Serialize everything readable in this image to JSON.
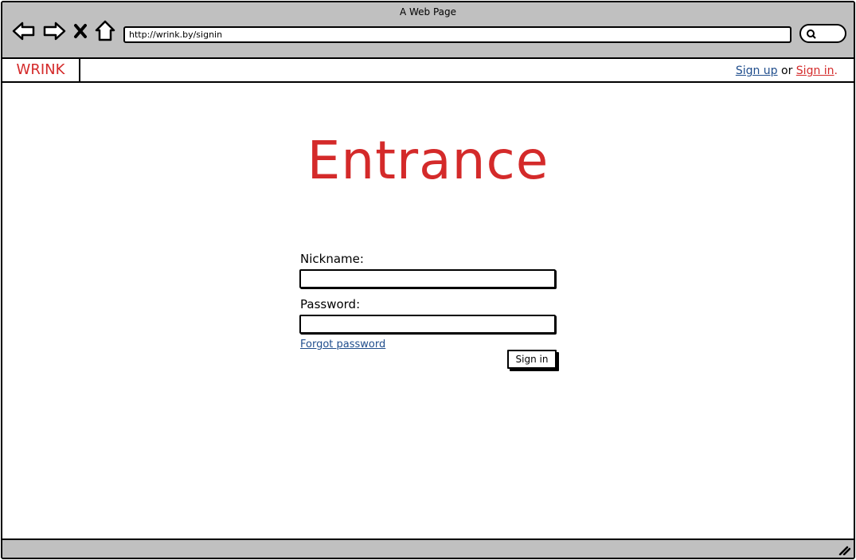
{
  "window": {
    "title": "A Web Page"
  },
  "browser": {
    "url": "http://wrink.by/signin",
    "icons": [
      "back-arrow-icon",
      "forward-arrow-icon",
      "close-x-icon",
      "home-icon",
      "search-icon"
    ]
  },
  "header": {
    "brand": "WRINK",
    "sign_up": "Sign up",
    "or": "or",
    "sign_in": "Sign in",
    "period": "."
  },
  "main": {
    "title": "Entrance",
    "nickname_label": "Nickname:",
    "password_label": "Password:",
    "forgot_link": "Forgot password",
    "submit_label": "Sign in"
  },
  "colors": {
    "accent": "#d42a2a",
    "link": "#1f4d8c",
    "chrome": "#c0c0c0"
  }
}
